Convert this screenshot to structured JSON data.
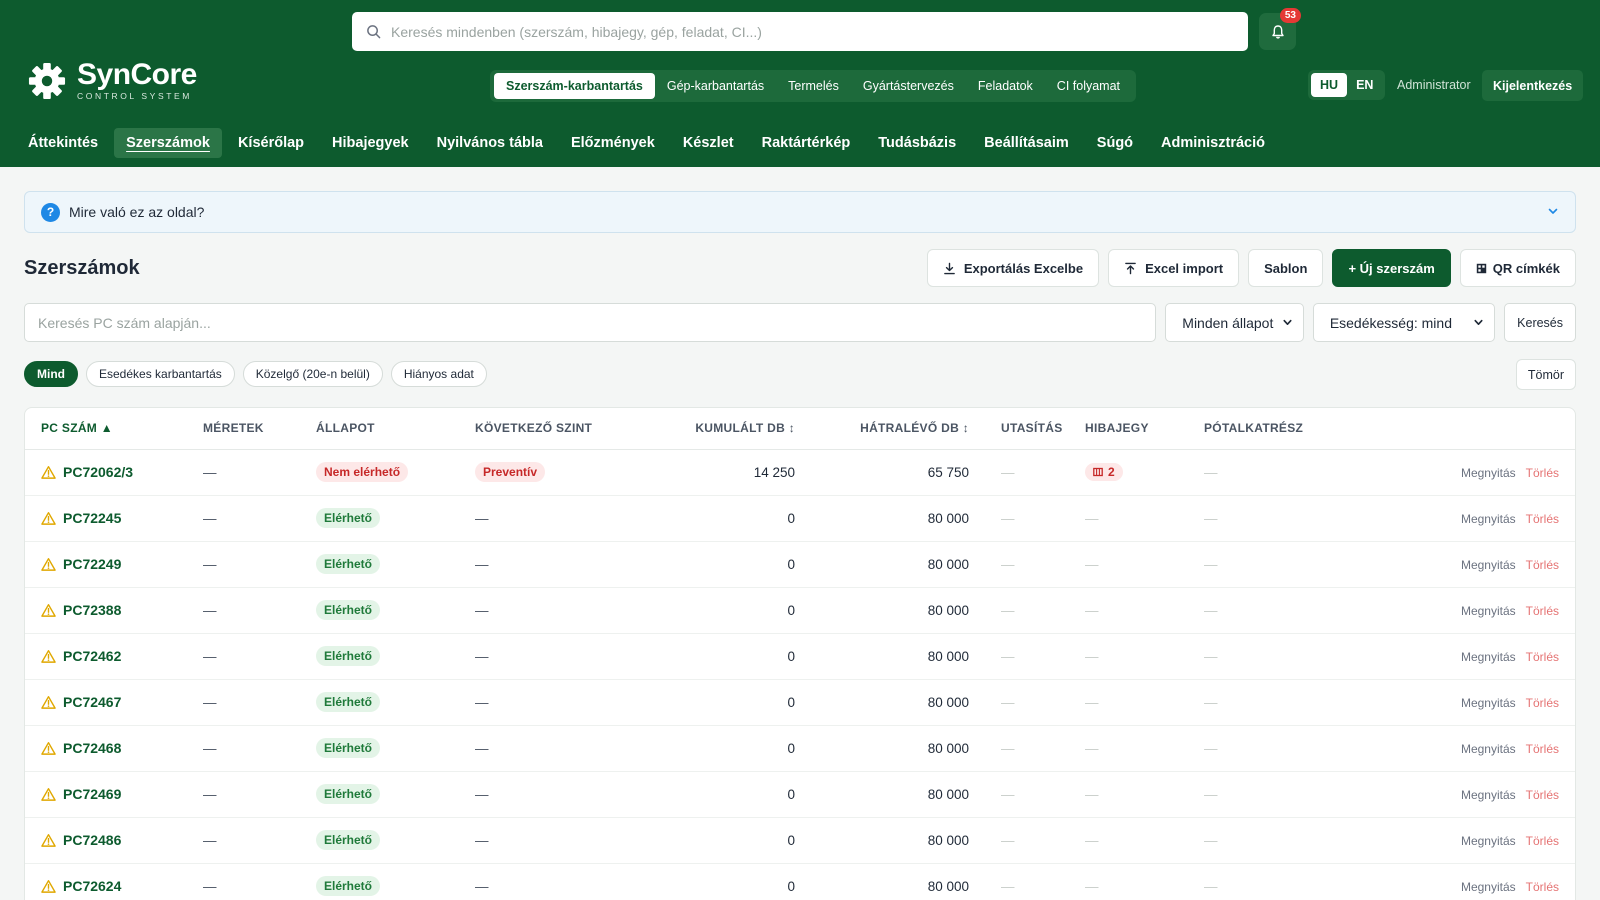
{
  "header": {
    "search_placeholder": "Keresés mindenben (szerszám, hibajegy, gép, feladat, CI...)",
    "notifications_count": "53",
    "logo": {
      "name": "SynCore",
      "subtitle": "CONTROL SYSTEM"
    },
    "module_tabs": [
      {
        "label": "Szerszám-karbantartás",
        "active": true
      },
      {
        "label": "Gép-karbantartás",
        "active": false
      },
      {
        "label": "Termelés",
        "active": false
      },
      {
        "label": "Gyártástervezés",
        "active": false
      },
      {
        "label": "Feladatok",
        "active": false
      },
      {
        "label": "CI folyamat",
        "active": false
      }
    ],
    "languages": [
      {
        "label": "HU",
        "active": true
      },
      {
        "label": "EN",
        "active": false
      }
    ],
    "user": "Administrator",
    "logout_label": "Kijelentkezés"
  },
  "nav": [
    {
      "label": "Áttekintés",
      "active": false
    },
    {
      "label": "Szerszámok",
      "active": true
    },
    {
      "label": "Kísérőlap",
      "active": false
    },
    {
      "label": "Hibajegyek",
      "active": false
    },
    {
      "label": "Nyilvános tábla",
      "active": false
    },
    {
      "label": "Előzmények",
      "active": false
    },
    {
      "label": "Készlet",
      "active": false
    },
    {
      "label": "Raktártérkép",
      "active": false
    },
    {
      "label": "Tudásbázis",
      "active": false
    },
    {
      "label": "Beállításaim",
      "active": false
    },
    {
      "label": "Súgó",
      "active": false
    },
    {
      "label": "Adminisztráció",
      "active": false
    }
  ],
  "help": {
    "icon": "?",
    "text": "Mire való ez az oldal?"
  },
  "page": {
    "title": "Szerszámok",
    "actions": {
      "export": "Exportálás Excelbe",
      "import": "Excel import",
      "template": "Sablon",
      "new_tool": "+ Új szerszám",
      "qr": "QR címkék"
    }
  },
  "filters": {
    "search_placeholder": "Keresés PC szám alapján...",
    "status_select": "Minden állapot",
    "due_select": "Esedékesség: mind",
    "search_button": "Keresés",
    "chips": [
      {
        "label": "Mind",
        "active": true
      },
      {
        "label": "Esedékes karbantartás",
        "active": false
      },
      {
        "label": "Közelgő (20e-n belül)",
        "active": false
      },
      {
        "label": "Hiányos adat",
        "active": false
      }
    ],
    "compact_button": "Tömör"
  },
  "table": {
    "columns": {
      "pc": "PC SZÁM ▲",
      "dims": "MÉRETEK",
      "status": "ÁLLAPOT",
      "next_level": "KÖVETKEZŐ SZINT",
      "cumulative": "KUMULÁLT DB ↕",
      "remaining": "HÁTRALÉVŐ DB ↕",
      "instruction": "UTASÍTÁS",
      "ticket": "HIBAJEGY",
      "spare": "PÓTALKATRÉSZ"
    },
    "open_label": "Megnyitás",
    "delete_label": "Törlés",
    "dash": "—",
    "rows": [
      {
        "pc": "PC72062/3",
        "dims": "—",
        "status": "Nem elérhető",
        "status_type": "unavail",
        "next_level": "Preventív",
        "cumulative": "14 250",
        "remaining": "65 750",
        "instruction": "—",
        "ticket": "2",
        "spare": "—"
      },
      {
        "pc": "PC72245",
        "dims": "—",
        "status": "Elérhető",
        "status_type": "avail",
        "next_level": "—",
        "cumulative": "0",
        "remaining": "80 000",
        "instruction": "—",
        "ticket": "—",
        "spare": "—"
      },
      {
        "pc": "PC72249",
        "dims": "—",
        "status": "Elérhető",
        "status_type": "avail",
        "next_level": "—",
        "cumulative": "0",
        "remaining": "80 000",
        "instruction": "—",
        "ticket": "—",
        "spare": "—"
      },
      {
        "pc": "PC72388",
        "dims": "—",
        "status": "Elérhető",
        "status_type": "avail",
        "next_level": "—",
        "cumulative": "0",
        "remaining": "80 000",
        "instruction": "—",
        "ticket": "—",
        "spare": "—"
      },
      {
        "pc": "PC72462",
        "dims": "—",
        "status": "Elérhető",
        "status_type": "avail",
        "next_level": "—",
        "cumulative": "0",
        "remaining": "80 000",
        "instruction": "—",
        "ticket": "—",
        "spare": "—"
      },
      {
        "pc": "PC72467",
        "dims": "—",
        "status": "Elérhető",
        "status_type": "avail",
        "next_level": "—",
        "cumulative": "0",
        "remaining": "80 000",
        "instruction": "—",
        "ticket": "—",
        "spare": "—"
      },
      {
        "pc": "PC72468",
        "dims": "—",
        "status": "Elérhető",
        "status_type": "avail",
        "next_level": "—",
        "cumulative": "0",
        "remaining": "80 000",
        "instruction": "—",
        "ticket": "—",
        "spare": "—"
      },
      {
        "pc": "PC72469",
        "dims": "—",
        "status": "Elérhető",
        "status_type": "avail",
        "next_level": "—",
        "cumulative": "0",
        "remaining": "80 000",
        "instruction": "—",
        "ticket": "—",
        "spare": "—"
      },
      {
        "pc": "PC72486",
        "dims": "—",
        "status": "Elérhető",
        "status_type": "avail",
        "next_level": "—",
        "cumulative": "0",
        "remaining": "80 000",
        "instruction": "—",
        "ticket": "—",
        "spare": "—"
      },
      {
        "pc": "PC72624",
        "dims": "—",
        "status": "Elérhető",
        "status_type": "avail",
        "next_level": "—",
        "cumulative": "0",
        "remaining": "80 000",
        "instruction": "—",
        "ticket": "—",
        "spare": "—"
      }
    ]
  },
  "colors": {
    "brand": "#0d5b2e",
    "available": "#1f7a3a",
    "unavailable": "#c62828",
    "warning": "#e0a800",
    "delete": "#e57373"
  },
  "icons": {
    "search": "search-icon",
    "bell": "bell-icon",
    "gear_logo": "gear-icon",
    "help": "help-icon",
    "chevron": "chevron-down-icon",
    "download": "download-icon",
    "upload": "upload-icon",
    "qr": "qr-icon",
    "warning": "warning-icon",
    "ticket": "ticket-icon"
  }
}
